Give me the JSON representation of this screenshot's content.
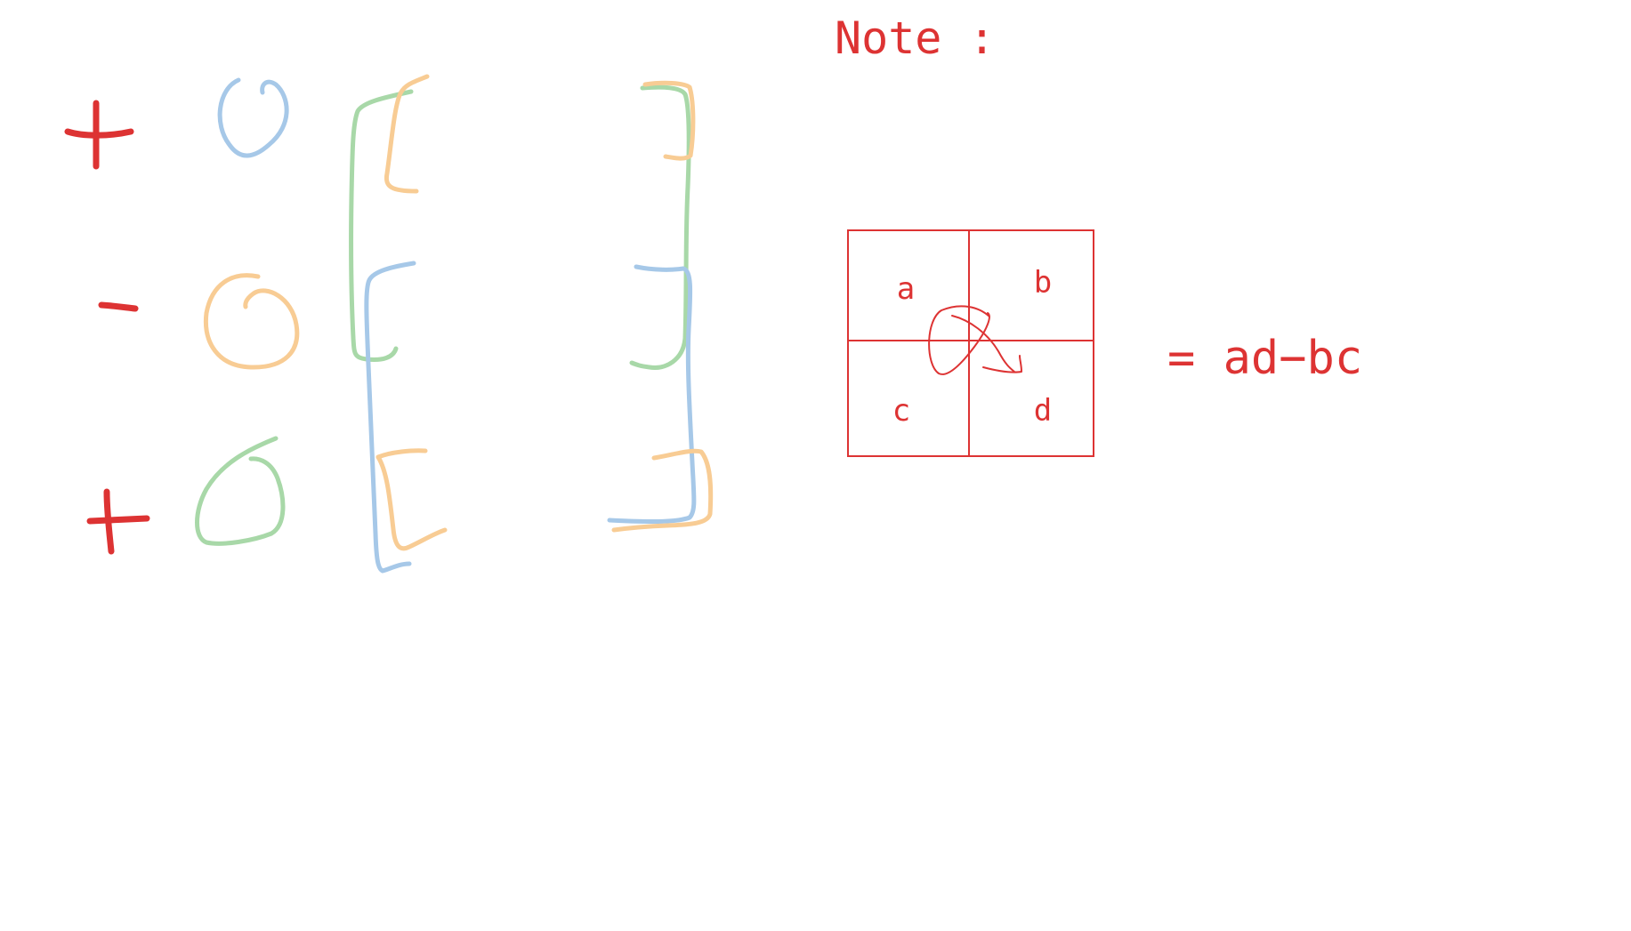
{
  "note": {
    "title": "Note :"
  },
  "grid": {
    "cells": {
      "a": "a",
      "b": "b",
      "c": "c",
      "d": "d"
    }
  },
  "formula": "= ad−bc",
  "colors": {
    "red": "#dd3333",
    "blue": "#a6c8e8",
    "orange": "#f8cc94",
    "green": "#a8d8a8"
  }
}
